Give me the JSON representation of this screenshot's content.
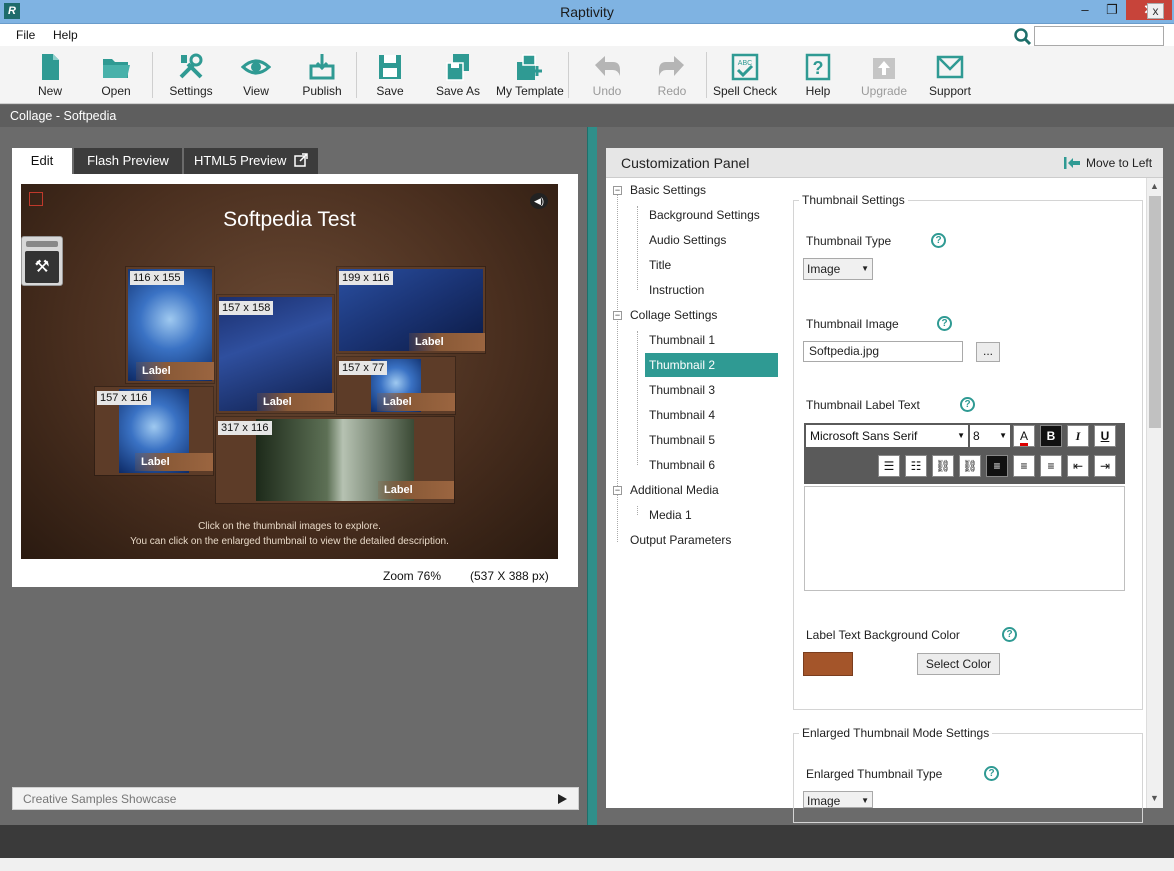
{
  "window": {
    "title": "Raptivity",
    "logo": "R",
    "minimize": "–",
    "maximize": "❐",
    "close": "✕"
  },
  "menu": {
    "items": [
      "File",
      "Help"
    ]
  },
  "search": {
    "placeholder": ""
  },
  "toolbar": {
    "new": "New",
    "open": "Open",
    "settings": "Settings",
    "view": "View",
    "publish": "Publish",
    "save": "Save",
    "save_as": "Save As",
    "my_template": "My Template",
    "undo": "Undo",
    "redo": "Redo",
    "spell_check": "Spell Check",
    "help": "Help",
    "upgrade": "Upgrade",
    "support": "Support",
    "disabled": [
      "Undo",
      "Redo",
      "Upgrade"
    ]
  },
  "document": {
    "title": "Collage - Softpedia",
    "close": "x"
  },
  "tabs": {
    "edit": "Edit",
    "flash": "Flash Preview",
    "html5": "HTML5 Preview"
  },
  "stage": {
    "title": "Softpedia Test",
    "line1": "Click on the thumbnail images to explore.",
    "line2": "You can click on the enlarged thumbnail to view the detailed description.",
    "thumbnails": [
      {
        "size": "116 x 155",
        "label": "Label"
      },
      {
        "size": "157 x 158",
        "label": "Label"
      },
      {
        "size": "199 x 116",
        "label": "Label"
      },
      {
        "size": "157 x 77",
        "label": "Label"
      },
      {
        "size": "157 x 116",
        "label": "Label"
      },
      {
        "size": "317 x 116",
        "label": "Label"
      }
    ]
  },
  "zoom": {
    "label": "Zoom  76%",
    "px": "(537 X 388 px)"
  },
  "showcase": {
    "label": "Creative Samples Showcase"
  },
  "panel": {
    "title": "Customization Panel",
    "move_left": "Move to Left",
    "tree": {
      "basic": "Basic Settings",
      "background": "Background Settings",
      "audio": "Audio Settings",
      "title": "Title",
      "instruction": "Instruction",
      "collage": "Collage Settings",
      "thumbnails": [
        "Thumbnail  1",
        "Thumbnail  2",
        "Thumbnail  3",
        "Thumbnail  4",
        "Thumbnail  5",
        "Thumbnail  6"
      ],
      "additional": "Additional Media",
      "media1": "Media  1",
      "output": "Output Parameters"
    },
    "thumbnail_settings": {
      "group_title": "Thumbnail Settings",
      "type_label": "Thumbnail Type",
      "type_value": "Image",
      "image_label": "Thumbnail Image",
      "image_value": "Softpedia.jpg",
      "browse": "...",
      "label_text_label": "Thumbnail Label Text",
      "font": "Microsoft Sans Serif",
      "font_size": "8",
      "bg_color_label": "Label Text Background Color",
      "bg_color": "#a4552a",
      "select_color": "Select Color"
    },
    "enlarged": {
      "group_title": "Enlarged Thumbnail Mode Settings",
      "type_label": "Enlarged Thumbnail Type",
      "type_value": "Image"
    }
  },
  "colors": {
    "accent": "#2f9a93",
    "stage_bg": "#4a2f1f",
    "titlebar": "#7fb3e2"
  }
}
